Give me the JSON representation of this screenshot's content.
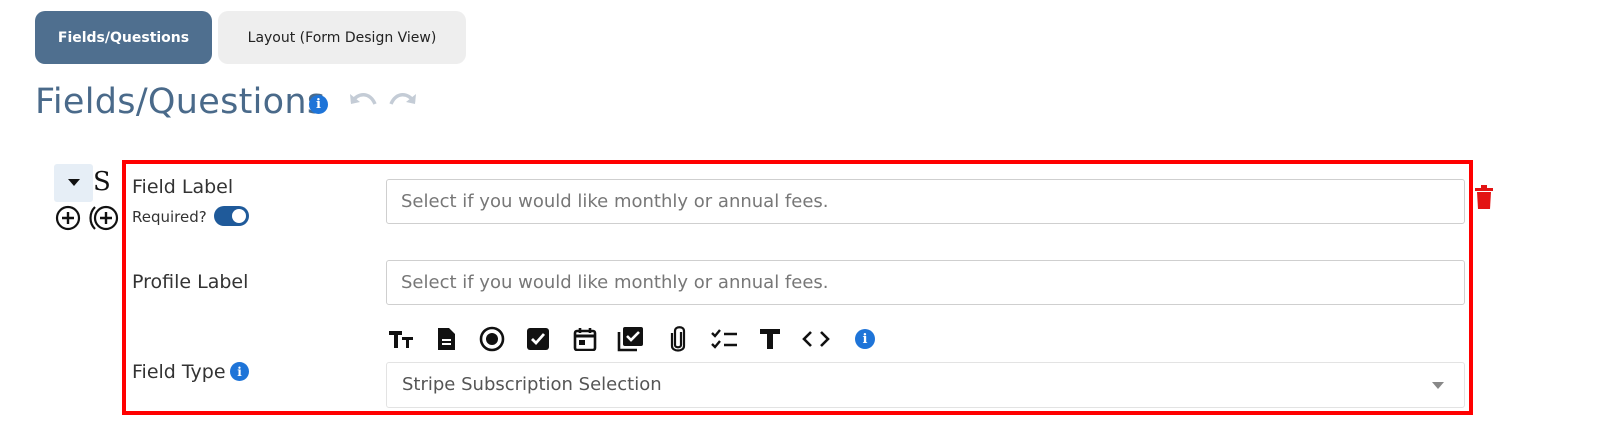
{
  "tabs": {
    "fields_questions": "Fields/Questions",
    "layout": "Layout (Form Design View)"
  },
  "page": {
    "title": "Fields/Questions",
    "s_letter": "S"
  },
  "field": {
    "field_label": "Field Label",
    "required_label": "Required?",
    "required_on": true,
    "field_label_placeholder": "Select if you would like monthly or annual fees.",
    "profile_label": "Profile Label",
    "profile_label_placeholder": "Select if you would like monthly or annual fees.",
    "field_type_label": "Field Type",
    "field_type_value": "Stripe Subscription Selection",
    "field_type_icons": [
      "text-size-icon",
      "document-icon",
      "radio-icon",
      "checkbox-icon",
      "calendar-icon",
      "multi-checkbox-icon",
      "paperclip-icon",
      "checklist-icon",
      "text-t-icon",
      "code-icon",
      "info-icon"
    ]
  },
  "colors": {
    "accent": "#4f6f8f",
    "title": "#4a6a8a",
    "highlight_border": "#ff0000",
    "info": "#1e74d8",
    "toggle": "#1f5a9a",
    "delete": "#e31414"
  }
}
